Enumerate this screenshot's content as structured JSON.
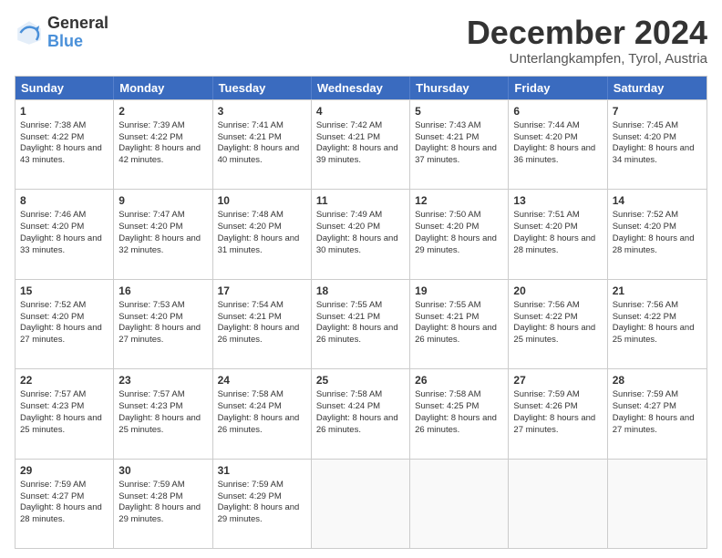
{
  "logo": {
    "general": "General",
    "blue": "Blue"
  },
  "title": {
    "month": "December 2024",
    "location": "Unterlangkampfen, Tyrol, Austria"
  },
  "header_days": [
    "Sunday",
    "Monday",
    "Tuesday",
    "Wednesday",
    "Thursday",
    "Friday",
    "Saturday"
  ],
  "weeks": [
    [
      {
        "day": "1",
        "sunrise": "Sunrise: 7:38 AM",
        "sunset": "Sunset: 4:22 PM",
        "daylight": "Daylight: 8 hours and 43 minutes."
      },
      {
        "day": "2",
        "sunrise": "Sunrise: 7:39 AM",
        "sunset": "Sunset: 4:22 PM",
        "daylight": "Daylight: 8 hours and 42 minutes."
      },
      {
        "day": "3",
        "sunrise": "Sunrise: 7:41 AM",
        "sunset": "Sunset: 4:21 PM",
        "daylight": "Daylight: 8 hours and 40 minutes."
      },
      {
        "day": "4",
        "sunrise": "Sunrise: 7:42 AM",
        "sunset": "Sunset: 4:21 PM",
        "daylight": "Daylight: 8 hours and 39 minutes."
      },
      {
        "day": "5",
        "sunrise": "Sunrise: 7:43 AM",
        "sunset": "Sunset: 4:21 PM",
        "daylight": "Daylight: 8 hours and 37 minutes."
      },
      {
        "day": "6",
        "sunrise": "Sunrise: 7:44 AM",
        "sunset": "Sunset: 4:20 PM",
        "daylight": "Daylight: 8 hours and 36 minutes."
      },
      {
        "day": "7",
        "sunrise": "Sunrise: 7:45 AM",
        "sunset": "Sunset: 4:20 PM",
        "daylight": "Daylight: 8 hours and 34 minutes."
      }
    ],
    [
      {
        "day": "8",
        "sunrise": "Sunrise: 7:46 AM",
        "sunset": "Sunset: 4:20 PM",
        "daylight": "Daylight: 8 hours and 33 minutes."
      },
      {
        "day": "9",
        "sunrise": "Sunrise: 7:47 AM",
        "sunset": "Sunset: 4:20 PM",
        "daylight": "Daylight: 8 hours and 32 minutes."
      },
      {
        "day": "10",
        "sunrise": "Sunrise: 7:48 AM",
        "sunset": "Sunset: 4:20 PM",
        "daylight": "Daylight: 8 hours and 31 minutes."
      },
      {
        "day": "11",
        "sunrise": "Sunrise: 7:49 AM",
        "sunset": "Sunset: 4:20 PM",
        "daylight": "Daylight: 8 hours and 30 minutes."
      },
      {
        "day": "12",
        "sunrise": "Sunrise: 7:50 AM",
        "sunset": "Sunset: 4:20 PM",
        "daylight": "Daylight: 8 hours and 29 minutes."
      },
      {
        "day": "13",
        "sunrise": "Sunrise: 7:51 AM",
        "sunset": "Sunset: 4:20 PM",
        "daylight": "Daylight: 8 hours and 28 minutes."
      },
      {
        "day": "14",
        "sunrise": "Sunrise: 7:52 AM",
        "sunset": "Sunset: 4:20 PM",
        "daylight": "Daylight: 8 hours and 28 minutes."
      }
    ],
    [
      {
        "day": "15",
        "sunrise": "Sunrise: 7:52 AM",
        "sunset": "Sunset: 4:20 PM",
        "daylight": "Daylight: 8 hours and 27 minutes."
      },
      {
        "day": "16",
        "sunrise": "Sunrise: 7:53 AM",
        "sunset": "Sunset: 4:20 PM",
        "daylight": "Daylight: 8 hours and 27 minutes."
      },
      {
        "day": "17",
        "sunrise": "Sunrise: 7:54 AM",
        "sunset": "Sunset: 4:21 PM",
        "daylight": "Daylight: 8 hours and 26 minutes."
      },
      {
        "day": "18",
        "sunrise": "Sunrise: 7:55 AM",
        "sunset": "Sunset: 4:21 PM",
        "daylight": "Daylight: 8 hours and 26 minutes."
      },
      {
        "day": "19",
        "sunrise": "Sunrise: 7:55 AM",
        "sunset": "Sunset: 4:21 PM",
        "daylight": "Daylight: 8 hours and 26 minutes."
      },
      {
        "day": "20",
        "sunrise": "Sunrise: 7:56 AM",
        "sunset": "Sunset: 4:22 PM",
        "daylight": "Daylight: 8 hours and 25 minutes."
      },
      {
        "day": "21",
        "sunrise": "Sunrise: 7:56 AM",
        "sunset": "Sunset: 4:22 PM",
        "daylight": "Daylight: 8 hours and 25 minutes."
      }
    ],
    [
      {
        "day": "22",
        "sunrise": "Sunrise: 7:57 AM",
        "sunset": "Sunset: 4:23 PM",
        "daylight": "Daylight: 8 hours and 25 minutes."
      },
      {
        "day": "23",
        "sunrise": "Sunrise: 7:57 AM",
        "sunset": "Sunset: 4:23 PM",
        "daylight": "Daylight: 8 hours and 25 minutes."
      },
      {
        "day": "24",
        "sunrise": "Sunrise: 7:58 AM",
        "sunset": "Sunset: 4:24 PM",
        "daylight": "Daylight: 8 hours and 26 minutes."
      },
      {
        "day": "25",
        "sunrise": "Sunrise: 7:58 AM",
        "sunset": "Sunset: 4:24 PM",
        "daylight": "Daylight: 8 hours and 26 minutes."
      },
      {
        "day": "26",
        "sunrise": "Sunrise: 7:58 AM",
        "sunset": "Sunset: 4:25 PM",
        "daylight": "Daylight: 8 hours and 26 minutes."
      },
      {
        "day": "27",
        "sunrise": "Sunrise: 7:59 AM",
        "sunset": "Sunset: 4:26 PM",
        "daylight": "Daylight: 8 hours and 27 minutes."
      },
      {
        "day": "28",
        "sunrise": "Sunrise: 7:59 AM",
        "sunset": "Sunset: 4:27 PM",
        "daylight": "Daylight: 8 hours and 27 minutes."
      }
    ],
    [
      {
        "day": "29",
        "sunrise": "Sunrise: 7:59 AM",
        "sunset": "Sunset: 4:27 PM",
        "daylight": "Daylight: 8 hours and 28 minutes."
      },
      {
        "day": "30",
        "sunrise": "Sunrise: 7:59 AM",
        "sunset": "Sunset: 4:28 PM",
        "daylight": "Daylight: 8 hours and 29 minutes."
      },
      {
        "day": "31",
        "sunrise": "Sunrise: 7:59 AM",
        "sunset": "Sunset: 4:29 PM",
        "daylight": "Daylight: 8 hours and 29 minutes."
      },
      null,
      null,
      null,
      null
    ]
  ]
}
